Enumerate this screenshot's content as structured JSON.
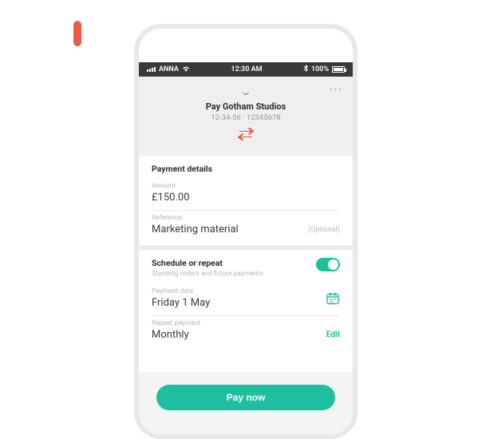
{
  "statusbar": {
    "carrier": "ANNA",
    "time": "12:30 AM",
    "battery": "100%"
  },
  "header": {
    "title": "Pay Gotham Studios",
    "subtitle": "12-34-56 · 12345678"
  },
  "details": {
    "section_title": "Payment details",
    "amount_label": "Amount",
    "amount_value": "£150.00",
    "reference_label": "Reference",
    "reference_value": "Marketing material",
    "reference_hint": "(Optional)"
  },
  "schedule": {
    "title": "Schedule or repeat",
    "subtitle": "Standing orders and future payments",
    "date_label": "Payment date",
    "date_value": "Friday 1 May",
    "repeat_label": "Repeat payment",
    "repeat_value": "Monthly",
    "edit_label": "Edit"
  },
  "footer": {
    "pay_label": "Pay now"
  },
  "colors": {
    "accent": "#1dbf9e",
    "swap": "#e85a44"
  }
}
